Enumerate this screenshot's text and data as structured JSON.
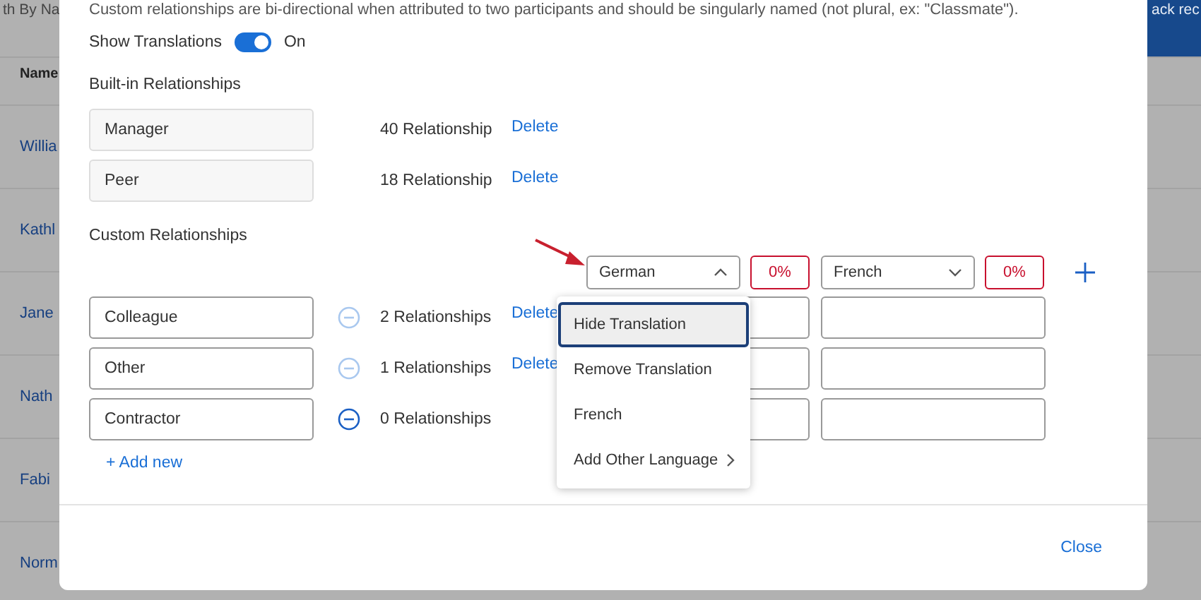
{
  "background": {
    "search_label": "th By Na",
    "header_button": "ack rec",
    "column_header": "Name",
    "names": [
      "Willia",
      "Kathl",
      "Jane",
      "Nath",
      "Fabi",
      "Norm"
    ]
  },
  "dialog": {
    "intro": "Custom relationships are bi-directional when attributed to two participants and should be singularly named (not plural, ex: \"Classmate\").",
    "show_translations": {
      "label": "Show Translations",
      "on": true,
      "state_text": "On"
    },
    "built_in": {
      "title": "Built-in Relationships",
      "rows": [
        {
          "name": "Manager",
          "count": "40 Relationship",
          "delete": "Delete"
        },
        {
          "name": "Peer",
          "count": "18 Relationship",
          "delete": "Delete"
        }
      ]
    },
    "custom": {
      "title": "Custom Relationships",
      "languages": [
        {
          "name": "German",
          "expanded": true,
          "progress": "0%"
        },
        {
          "name": "French",
          "expanded": false,
          "progress": "0%"
        }
      ],
      "rows": [
        {
          "name": "Colleague",
          "remove_disabled": true,
          "count": "2 Relationships",
          "delete": "Delete"
        },
        {
          "name": "Other",
          "remove_disabled": true,
          "count": "1 Relationships",
          "delete": "Delete"
        },
        {
          "name": "Contractor",
          "remove_disabled": false,
          "count": "0 Relationships"
        }
      ],
      "add_new": "+ Add new"
    },
    "language_menu": {
      "items": [
        {
          "label": "Hide Translation",
          "selected": true,
          "kind": "action"
        },
        {
          "label": "Remove Translation",
          "selected": false,
          "kind": "action"
        },
        {
          "label": "French",
          "selected": false,
          "kind": "action"
        },
        {
          "label": "Add Other Language",
          "selected": false,
          "kind": "submenu"
        }
      ]
    },
    "close": "Close"
  }
}
